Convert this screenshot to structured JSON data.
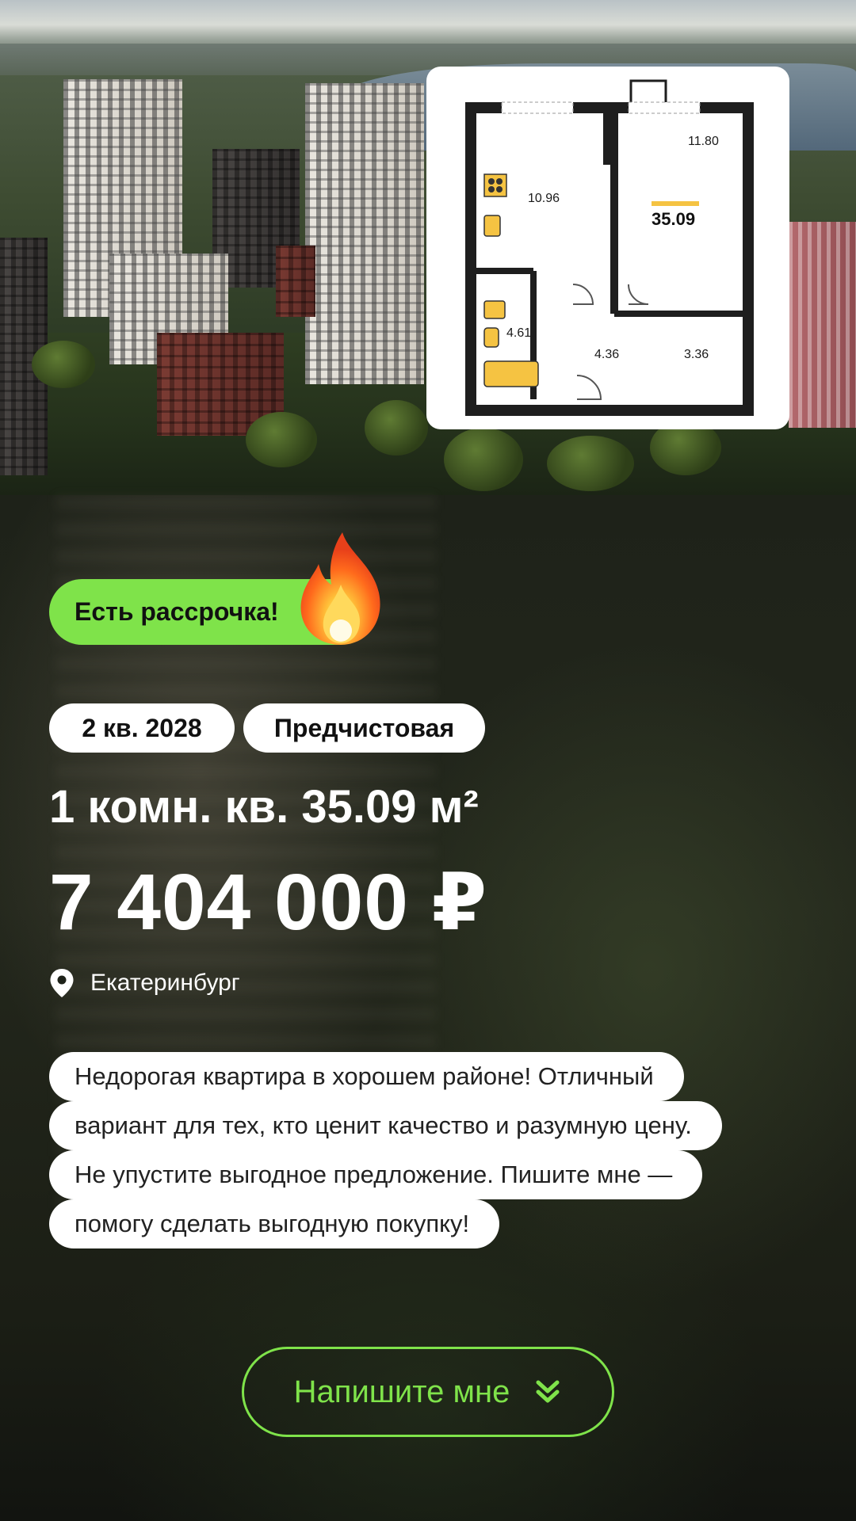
{
  "plan": {
    "rooms": [
      "10.96",
      "11.80",
      "4.61",
      "4.36",
      "3.36"
    ],
    "total_area": "35.09"
  },
  "badge": {
    "installment": "Есть рассрочка!",
    "icon": "fire-icon"
  },
  "chips": {
    "completion": "2 кв. 2028",
    "finish": "Предчистовая"
  },
  "listing": {
    "title": "1 комн. кв. 35.09 м²",
    "price": "7 404 000 ₽",
    "city": "Екатеринбург"
  },
  "description": [
    "Недорогая квартира в хорошем районе! Отличный",
    "вариант для тех, кто ценит качество и разумную цену.",
    "Не упустите выгодное предложение. Пишите мне —",
    "помогу сделать выгодную покупку!"
  ],
  "cta": {
    "label": "Напишите мне",
    "icon": "double-chevron-down-icon"
  },
  "colors": {
    "accent": "#7fe34a",
    "plan_highlight": "#f5c342"
  }
}
